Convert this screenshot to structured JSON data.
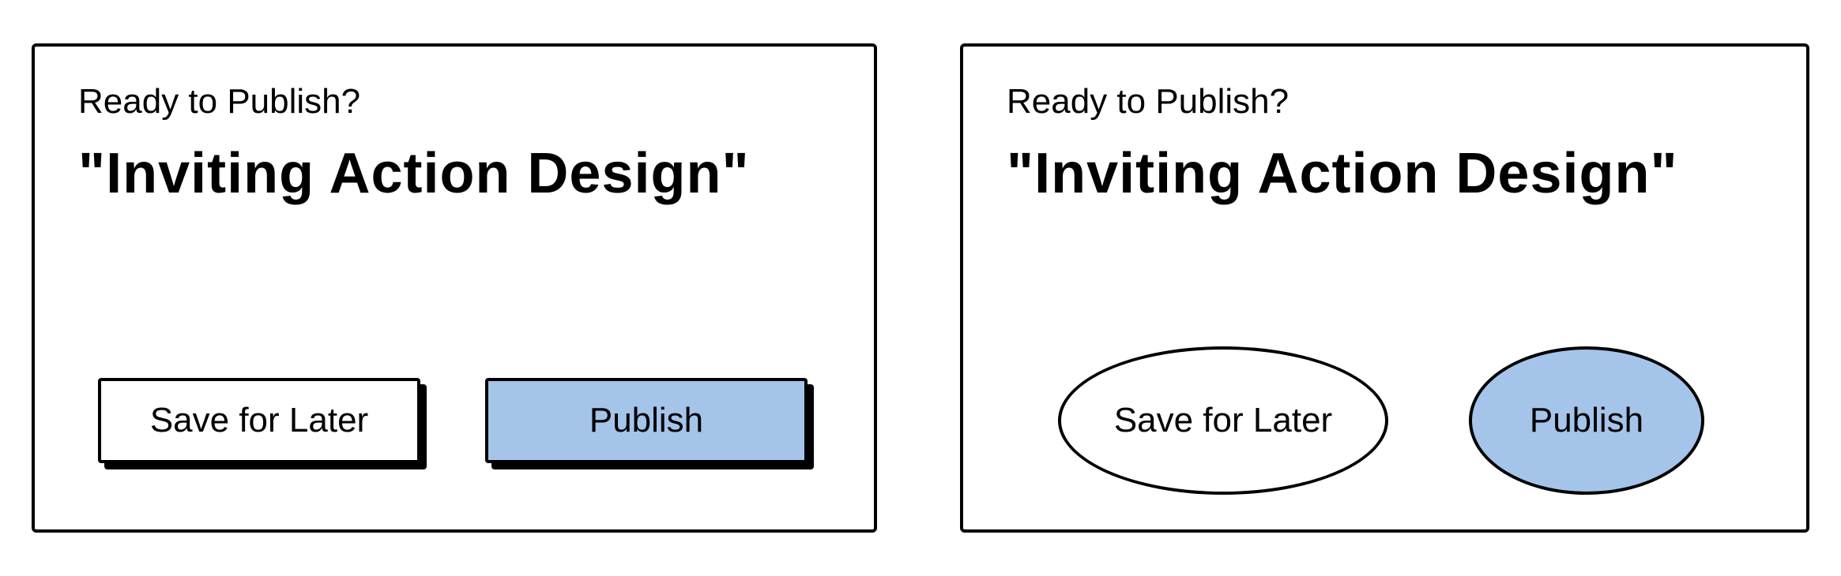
{
  "colors": {
    "accent": "#a5c4ea",
    "border": "#000000",
    "background": "#ffffff"
  },
  "left": {
    "prompt": "Ready to Publish?",
    "title": "\"Inviting Action Design\"",
    "save_label": "Save for Later",
    "publish_label": "Publish"
  },
  "right": {
    "prompt": "Ready to Publish?",
    "title": "\"Inviting Action Design\"",
    "save_label": "Save for Later",
    "publish_label": "Publish"
  }
}
